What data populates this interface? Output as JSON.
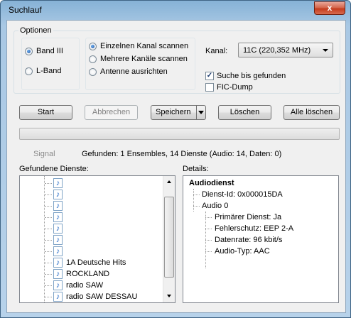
{
  "window": {
    "title": "Suchlauf",
    "close_glyph": "x"
  },
  "options": {
    "group_label": "Optionen",
    "band_iii": "Band III",
    "l_band": "L-Band",
    "band_selected": "Band III",
    "scan_single": "Einzelnen Kanal scannen",
    "scan_multiple": "Mehrere Kanäle scannen",
    "align_antenna": "Antenne ausrichten",
    "scan_selected": "Einzelnen Kanal scannen",
    "channel_label": "Kanal:",
    "channel_value": "11C (220,352 MHz)",
    "search_until_found": "Suche bis gefunden",
    "search_until_found_checked": true,
    "fic_dump": "FIC-Dump",
    "fic_dump_checked": false
  },
  "toolbar": {
    "start": "Start",
    "abort": "Abbrechen",
    "save": "Speichern",
    "delete": "Löschen",
    "delete_all": "Alle löschen"
  },
  "progress": {
    "value_percent": 0
  },
  "status": {
    "signal": "Signal",
    "found": "Gefunden:  1 Ensembles, 14 Dienste (Audio: 14, Daten: 0)"
  },
  "services": {
    "label": "Gefundene Dienste:",
    "items": [
      "",
      "",
      "",
      "",
      "",
      "",
      "",
      "1A Deutsche Hits",
      "ROCKLAND",
      "radio SAW",
      "radio SAW DESSAU"
    ],
    "icon": "music-note-icon"
  },
  "details": {
    "label": "Details:",
    "heading": "Audiodienst",
    "service_id": "Dienst-Id: 0x000015DA",
    "audio": "Audio 0",
    "primary": "Primärer Dienst: Ja",
    "error_protection": "Fehlerschutz: EEP 2-A",
    "bitrate": "Datenrate: 96 kbit/s",
    "audio_type": "Audio-Typ: AAC"
  },
  "colors": {
    "title_bar": "#a9c8e4",
    "close_button": "#c43c1e",
    "dialog_bg": "#f0f0f0",
    "progress_fill": "#06b025"
  }
}
